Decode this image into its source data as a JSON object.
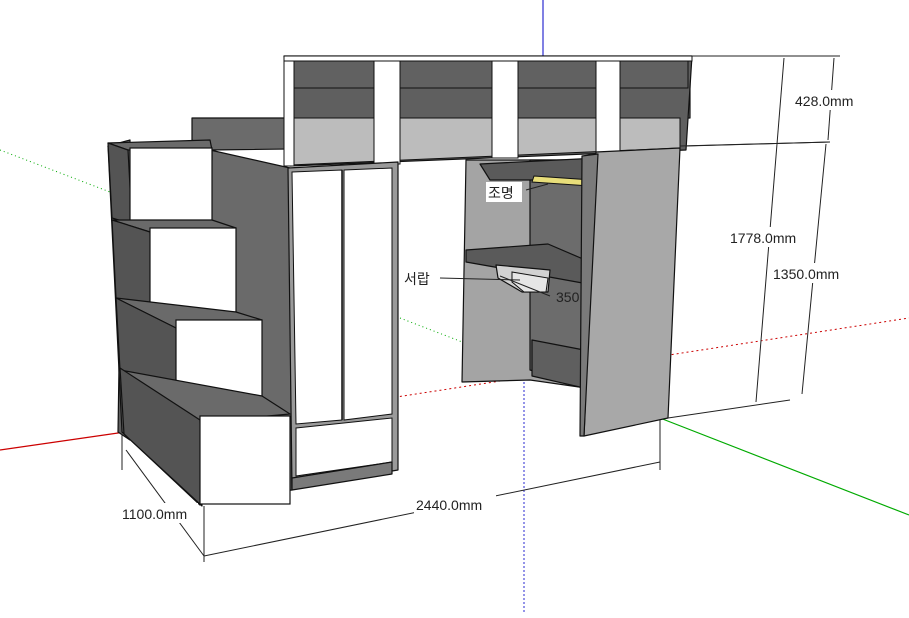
{
  "scene": {
    "description_free": true,
    "colors": {
      "background": "#ffffff",
      "panel_dark": "#5f5f5f",
      "panel_mid": "#7c7c7c",
      "panel_light": "#9a9a9a",
      "panel_face": "#a6a6a6",
      "door_white": "#ffffff",
      "lamp_yellow": "#e8de7a",
      "axis_red": "#cc0000",
      "axis_green": "#00aa00",
      "axis_blue": "#0000cc"
    }
  },
  "dimensions": {
    "top_height": "428.0mm",
    "total_height": "1778.0mm",
    "under_height": "1350.0mm",
    "depth": "1100.0mm",
    "width": "2440.0mm"
  },
  "labels": {
    "lighting": "조명",
    "drawer": "서랍",
    "drawer_depth": "350"
  }
}
